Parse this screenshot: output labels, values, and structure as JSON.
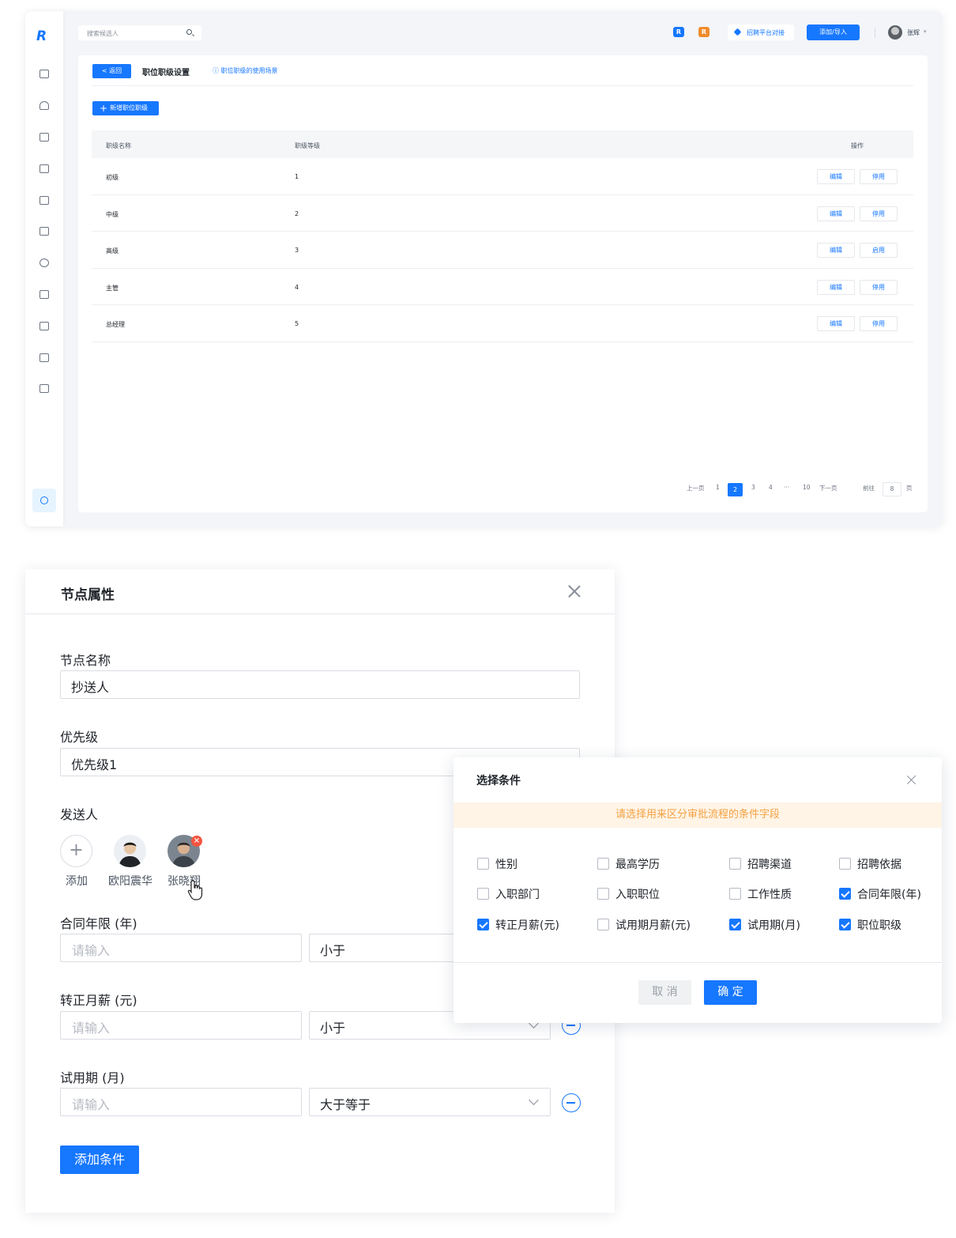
{
  "app": {
    "search_placeholder": "搜索候选人",
    "badges": [
      "R",
      "R"
    ],
    "platform_btn": "招聘平台对接",
    "add_btn": "添加/导入",
    "user": "张辉",
    "colors": {
      "accent": "#1677ff",
      "badge_blue": "#1677ff",
      "badge_orange": "#f08c2b"
    }
  },
  "panel": {
    "back_label": "< 返回",
    "title": "职位职级设置",
    "help_link": "职位职级的使用场景",
    "new_btn": "新增职位职级",
    "columns": [
      "职级名称",
      "职级等级",
      "操作"
    ],
    "rows": [
      {
        "name": "初级",
        "level": "1",
        "edit": "编辑",
        "toggle": "停用"
      },
      {
        "name": "中级",
        "level": "2",
        "edit": "编辑",
        "toggle": "停用"
      },
      {
        "name": "高级",
        "level": "3",
        "edit": "编辑",
        "toggle": "启用"
      },
      {
        "name": "主管",
        "level": "4",
        "edit": "编辑",
        "toggle": "停用"
      },
      {
        "name": "总经理",
        "level": "5",
        "edit": "编辑",
        "toggle": "停用"
      }
    ],
    "pager": {
      "prev": "上一页",
      "p1": "1",
      "current": "2",
      "p3": "3",
      "p4": "4",
      "ellipsis": "···",
      "last": "10",
      "next": "下一页",
      "goto": "前往",
      "goto_value": "8",
      "unit": "页"
    }
  },
  "node": {
    "title": "节点属性",
    "name_label": "节点名称",
    "name_value": "抄送人",
    "priority_label": "优先级",
    "priority_value": "优先级1",
    "sender_label": "发送人",
    "add_label": "添加",
    "people": [
      "欧阳震华",
      "张晓翔"
    ],
    "conditions": [
      {
        "label": "合同年限 (年)",
        "placeholder": "请输入",
        "op": "小于"
      },
      {
        "label": "转正月薪 (元)",
        "placeholder": "请输入",
        "op": "小于"
      },
      {
        "label": "试用期 (月)",
        "placeholder": "请输入",
        "op": "大于等于"
      }
    ],
    "add_condition": "添加条件"
  },
  "dialog": {
    "title": "选择条件",
    "tip": "请选择用来区分审批流程的条件字段",
    "options": [
      {
        "label": "性别",
        "checked": false
      },
      {
        "label": "最高学历",
        "checked": false
      },
      {
        "label": "招聘渠道",
        "checked": false
      },
      {
        "label": "招聘依据",
        "checked": false
      },
      {
        "label": "入职部门",
        "checked": false
      },
      {
        "label": "入职职位",
        "checked": false
      },
      {
        "label": "工作性质",
        "checked": false
      },
      {
        "label": "合同年限(年)",
        "checked": true
      },
      {
        "label": "转正月薪(元)",
        "checked": true
      },
      {
        "label": "试用期月薪(元)",
        "checked": false
      },
      {
        "label": "试用期(月)",
        "checked": true
      },
      {
        "label": "职位职级",
        "checked": true
      }
    ],
    "cancel": "取 消",
    "ok": "确 定"
  }
}
